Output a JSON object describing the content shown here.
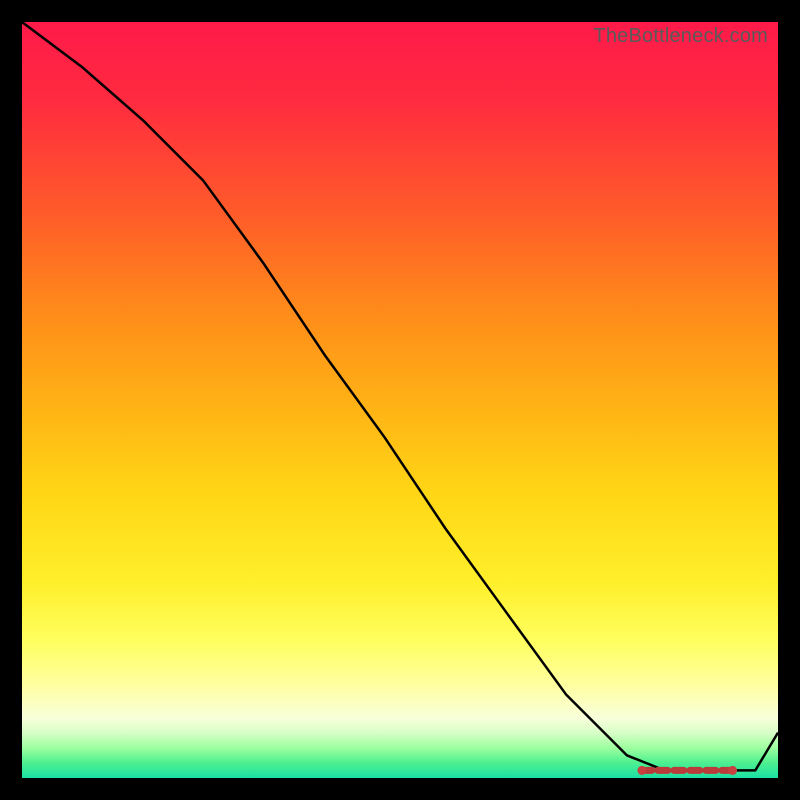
{
  "watermark": "TheBottleneck.com",
  "chart_data": {
    "type": "line",
    "title": "",
    "xlabel": "",
    "ylabel": "",
    "xlim": [
      0,
      100
    ],
    "ylim": [
      0,
      100
    ],
    "series": [
      {
        "name": "curve",
        "x": [
          0,
          8,
          16,
          24,
          32,
          40,
          48,
          56,
          64,
          72,
          80,
          85,
          89,
          93,
          97,
          100
        ],
        "y": [
          100,
          94,
          87,
          79,
          68,
          56,
          45,
          33,
          22,
          11,
          3,
          1,
          1,
          1,
          1,
          6
        ]
      }
    ],
    "markers": {
      "name": "highlight-segment",
      "x": [
        82,
        84,
        86,
        88,
        90,
        92,
        94
      ],
      "y": [
        1,
        1,
        1,
        1,
        1,
        1,
        1
      ]
    },
    "gradient_stops": [
      {
        "pos": 0,
        "color": "#ff1a4a"
      },
      {
        "pos": 50,
        "color": "#ffb015"
      },
      {
        "pos": 82,
        "color": "#ffff60"
      },
      {
        "pos": 100,
        "color": "#1ae0a5"
      }
    ]
  }
}
